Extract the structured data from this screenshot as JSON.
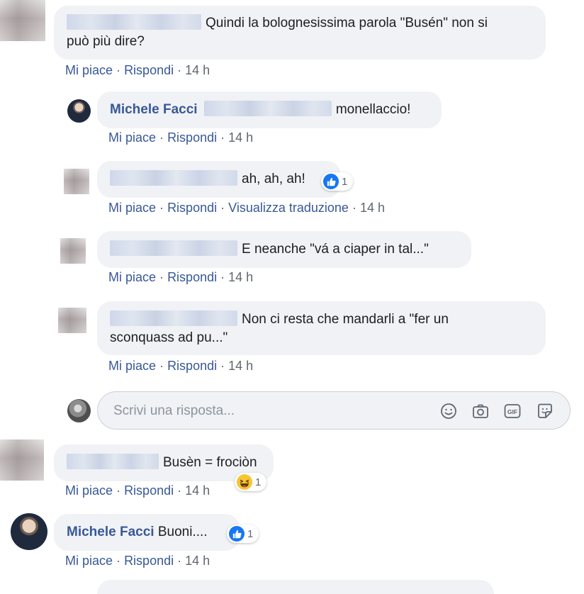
{
  "comments": [
    {
      "text_line1": "Quindi la bolognesissima parola \"Busén\" non si",
      "text_line2": "può più dire?",
      "actions": {
        "like": "Mi piace",
        "reply": "Rispondi",
        "time": "14 h"
      }
    },
    {
      "author": "Michele Facci",
      "text": "monellaccio!",
      "actions": {
        "like": "Mi piace",
        "reply": "Rispondi",
        "time": "14 h"
      }
    },
    {
      "text": "ah, ah, ah!",
      "reaction": {
        "type": "like",
        "count": "1"
      },
      "actions": {
        "like": "Mi piace",
        "reply": "Rispondi",
        "translate": "Visualizza traduzione",
        "time": "14 h"
      }
    },
    {
      "text": "E neanche \"vá a ciaper in tal...\"",
      "actions": {
        "like": "Mi piace",
        "reply": "Rispondi",
        "time": "14 h"
      }
    },
    {
      "text_line1": "Non ci resta che mandarli a \"fer un",
      "text_line2": "sconquass ad pu...\"",
      "actions": {
        "like": "Mi piace",
        "reply": "Rispondi",
        "time": "14 h"
      }
    },
    {
      "text": "Busèn = frociòn",
      "reaction": {
        "type": "haha",
        "count": "1"
      },
      "actions": {
        "like": "Mi piace",
        "reply": "Rispondi",
        "time": "14 h"
      }
    },
    {
      "author": "Michele Facci",
      "text": "Buoni....",
      "reaction": {
        "type": "like",
        "count": "1"
      },
      "actions": {
        "like": "Mi piace",
        "reply": "Rispondi",
        "time": "14 h"
      }
    }
  ],
  "reply_box": {
    "placeholder": "Scrivi una risposta...",
    "icons": [
      "emoji-icon",
      "camera-icon",
      "gif-icon",
      "sticker-icon"
    ]
  },
  "colors": {
    "link": "#385898",
    "meta": "#606770",
    "bubble": "#f0f2f5",
    "like_blue": "#1877f2",
    "haha_yellow": "#f7c531"
  },
  "separator": "·"
}
